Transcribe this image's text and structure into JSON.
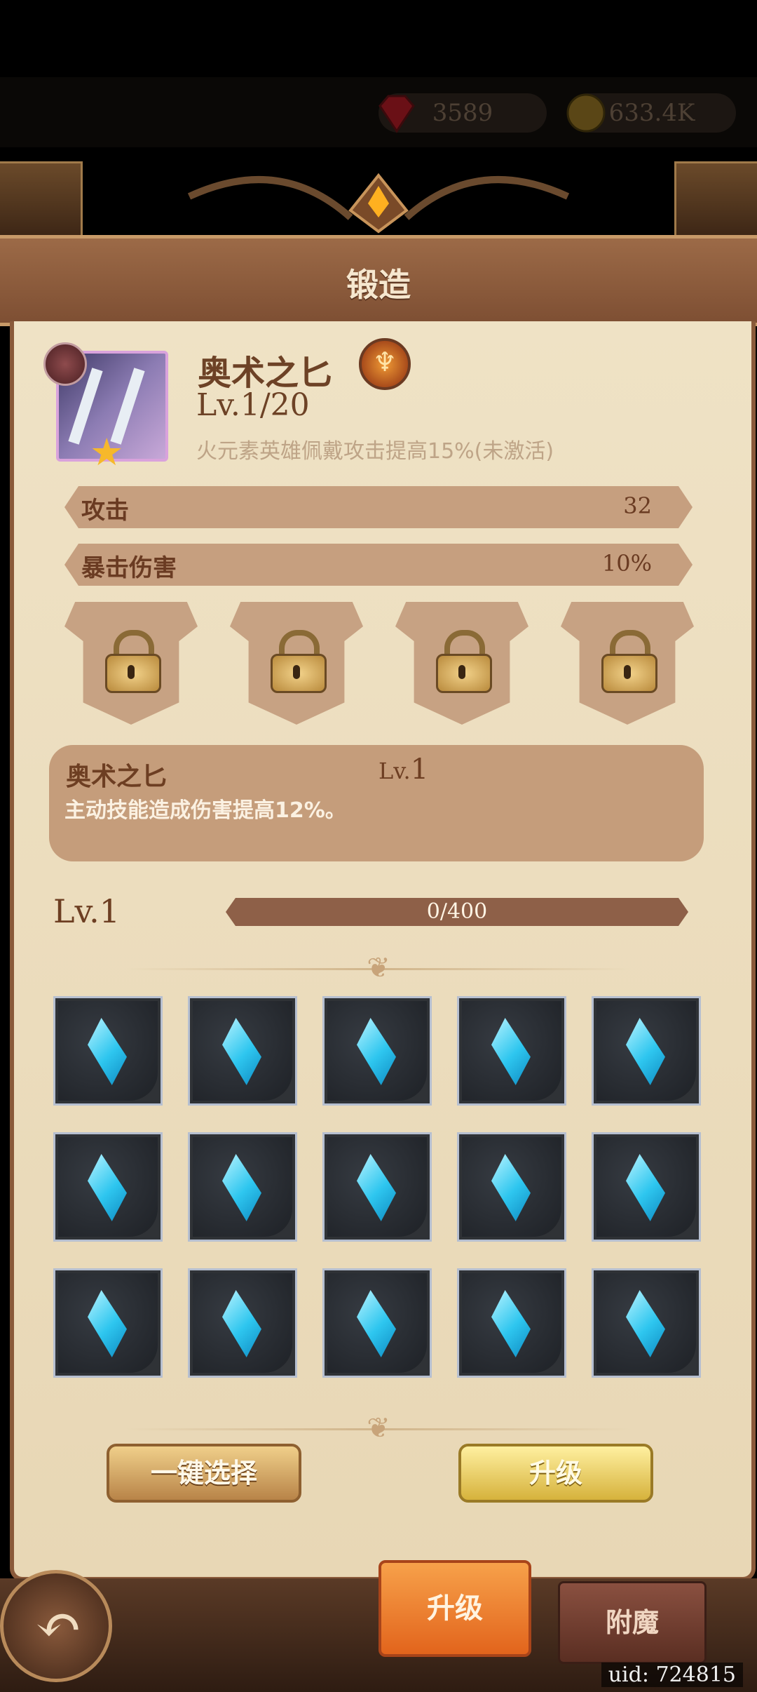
{
  "currency": {
    "gems": "3589",
    "coins": "633.4K"
  },
  "title": "锻造",
  "item": {
    "name": "奥术之匕",
    "level": "Lv.1/20",
    "bonus": "火元素英雄佩戴攻击提高15%(未激活)"
  },
  "stats": [
    {
      "label": "攻击",
      "value": "32"
    },
    {
      "label": "暴击伤害",
      "value": "10%"
    }
  ],
  "skill": {
    "name": "奥术之匕",
    "level_label": "Lv.",
    "level_value": "1",
    "desc": "主动技能造成伤害提高12%。"
  },
  "progress": {
    "level": "Lv.1",
    "text": "0/400",
    "fraction": 0
  },
  "buttons": {
    "quick_select": "一键选择",
    "upgrade": "升级"
  },
  "tabs": {
    "active": "升级",
    "other": "附魔"
  },
  "uid": "uid: 724815",
  "colors": {
    "accent": "#e2641c",
    "panel": "#efe2c5",
    "banner": "#8c5a3c"
  },
  "icons": [
    "gem-icon",
    "coin-icon",
    "element-fire-icon",
    "star-icon",
    "lock-icon",
    "crystal-icon",
    "back-arrow-icon"
  ]
}
